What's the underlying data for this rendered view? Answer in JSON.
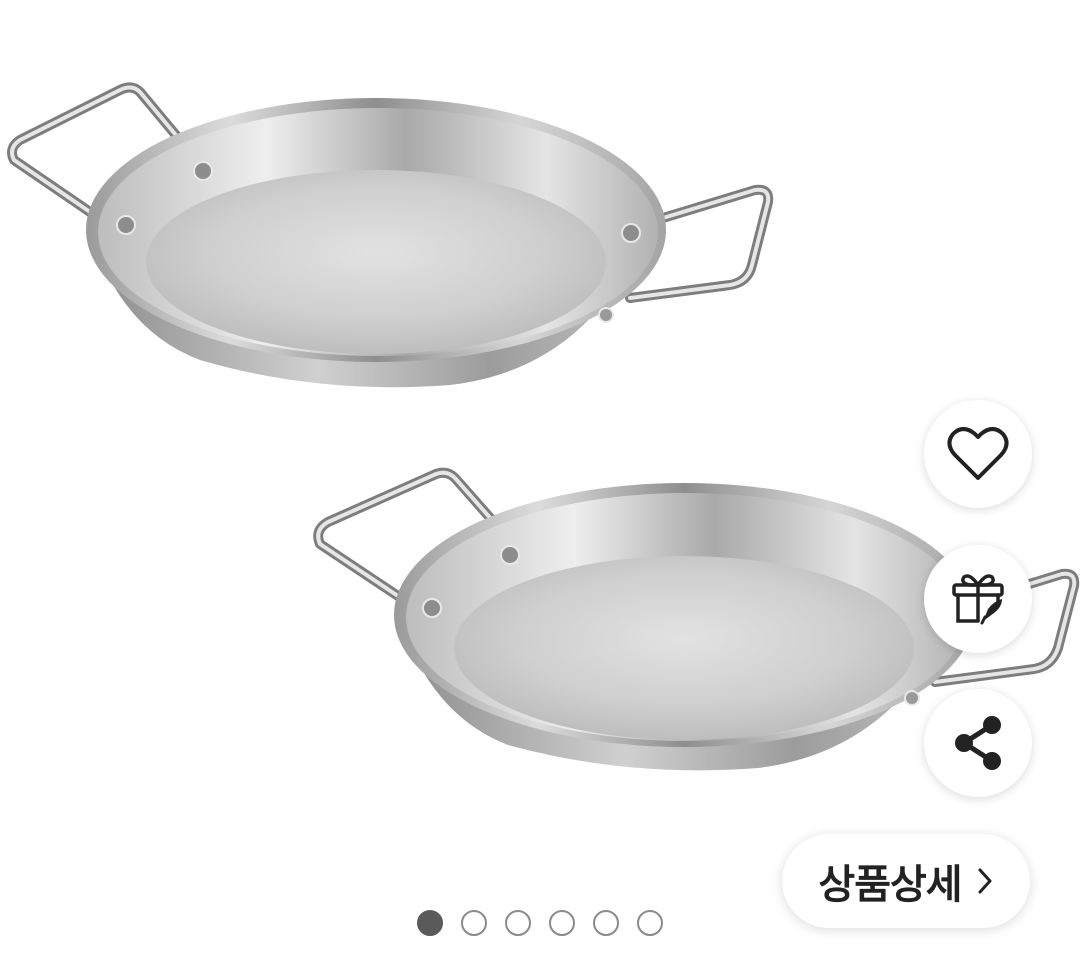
{
  "gallery": {
    "image_alt_icon": "stainless-paella-pan-pair",
    "page_count": 6,
    "active_index": 0
  },
  "actions": {
    "wishlist_icon": "heart-icon",
    "gift_icon": "gift-icon",
    "share_icon": "share-icon"
  },
  "detail_button": {
    "label": "상품상세",
    "icon": "chevron-right-icon"
  },
  "colors": {
    "background": "#ffffff",
    "icon": "#222222",
    "dot_active": "#5a5a5a",
    "dot_inactive_border": "#8a8a8a"
  }
}
